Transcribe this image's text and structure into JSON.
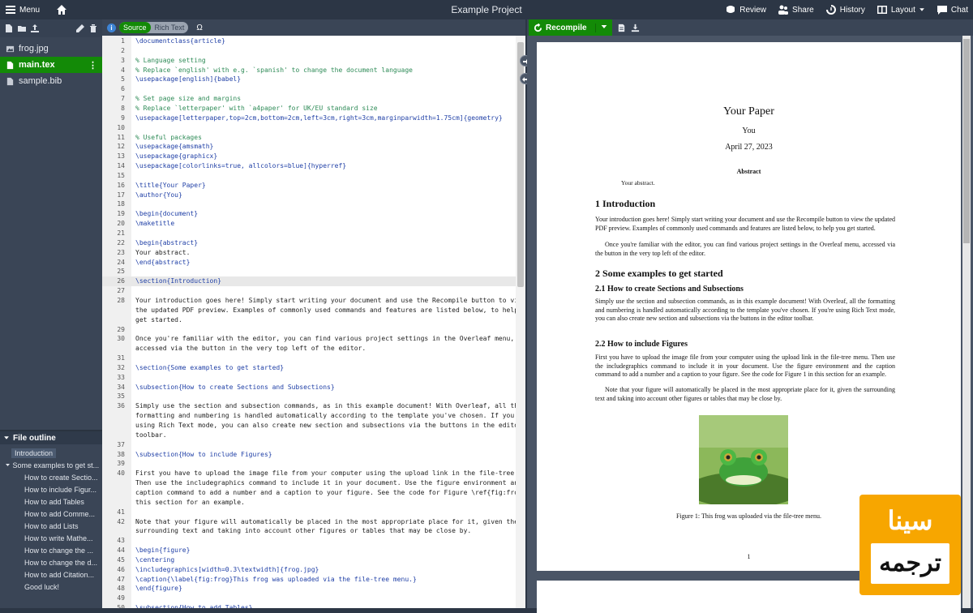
{
  "topbar": {
    "menu_label": "Menu",
    "project_title": "Example Project",
    "review": "Review",
    "share": "Share",
    "history": "History",
    "layout": "Layout",
    "chat": "Chat"
  },
  "files": [
    {
      "name": "frog.jpg"
    },
    {
      "name": "main.tex"
    },
    {
      "name": "sample.bib"
    }
  ],
  "outline": {
    "header": "File outline",
    "items": [
      {
        "label": "Introduction"
      },
      {
        "label": "Some examples to get st..."
      },
      {
        "label": "How to create Sectio..."
      },
      {
        "label": "How to include Figur..."
      },
      {
        "label": "How to add Tables"
      },
      {
        "label": "How to add Comme..."
      },
      {
        "label": "How to add Lists"
      },
      {
        "label": "How to write Mathe..."
      },
      {
        "label": "How to change the ..."
      },
      {
        "label": "How to change the d..."
      },
      {
        "label": "How to add Citation..."
      },
      {
        "label": "Good luck!"
      }
    ]
  },
  "editor": {
    "mode_source": "Source",
    "mode_rich": "Rich Text",
    "omega": "Ω",
    "info": "i",
    "lines": [
      {
        "n": "1",
        "t": "\\documentclass{article}"
      },
      {
        "n": "2",
        "t": ""
      },
      {
        "n": "3",
        "t": "% Language setting"
      },
      {
        "n": "4",
        "t": "% Replace `english' with e.g. `spanish' to change the document language"
      },
      {
        "n": "5",
        "t": "\\usepackage[english]{babel}"
      },
      {
        "n": "6",
        "t": ""
      },
      {
        "n": "7",
        "t": "% Set page size and margins"
      },
      {
        "n": "8",
        "t": "% Replace `letterpaper' with `a4paper' for UK/EU standard size"
      },
      {
        "n": "9",
        "t": "\\usepackage[letterpaper,top=2cm,bottom=2cm,left=3cm,right=3cm,marginparwidth=1.75cm]{geometry}"
      },
      {
        "n": "10",
        "t": ""
      },
      {
        "n": "11",
        "t": "% Useful packages"
      },
      {
        "n": "12",
        "t": "\\usepackage{amsmath}"
      },
      {
        "n": "13",
        "t": "\\usepackage{graphicx}"
      },
      {
        "n": "14",
        "t": "\\usepackage[colorlinks=true, allcolors=blue]{hyperref}"
      },
      {
        "n": "15",
        "t": ""
      },
      {
        "n": "16",
        "t": "\\title{Your Paper}"
      },
      {
        "n": "17",
        "t": "\\author{You}"
      },
      {
        "n": "18",
        "t": ""
      },
      {
        "n": "19",
        "t": "\\begin{document}"
      },
      {
        "n": "20",
        "t": "\\maketitle"
      },
      {
        "n": "21",
        "t": ""
      },
      {
        "n": "22",
        "t": "\\begin{abstract}"
      },
      {
        "n": "23",
        "t": "Your abstract."
      },
      {
        "n": "24",
        "t": "\\end{abstract}"
      },
      {
        "n": "25",
        "t": ""
      },
      {
        "n": "26",
        "t": "\\section{Introduction}"
      },
      {
        "n": "27",
        "t": ""
      },
      {
        "n": "28",
        "t": "Your introduction goes here! Simply start writing your document and use the Recompile button to view"
      },
      {
        "n": "",
        "t": "the updated PDF preview. Examples of commonly used commands and features are listed below, to help you"
      },
      {
        "n": "",
        "t": "get started."
      },
      {
        "n": "29",
        "t": ""
      },
      {
        "n": "30",
        "t": "Once you're familiar with the editor, you can find various project settings in the Overleaf menu,"
      },
      {
        "n": "",
        "t": "accessed via the button in the very top left of the editor."
      },
      {
        "n": "31",
        "t": ""
      },
      {
        "n": "32",
        "t": "\\section{Some examples to get started}"
      },
      {
        "n": "33",
        "t": ""
      },
      {
        "n": "34",
        "t": "\\subsection{How to create Sections and Subsections}"
      },
      {
        "n": "35",
        "t": ""
      },
      {
        "n": "36",
        "t": "Simply use the section and subsection commands, as in this example document! With Overleaf, all the"
      },
      {
        "n": "",
        "t": "formatting and numbering is handled automatically according to the template you've chosen. If you're"
      },
      {
        "n": "",
        "t": "using Rich Text mode, you can also create new section and subsections via the buttons in the editor"
      },
      {
        "n": "",
        "t": "toolbar."
      },
      {
        "n": "37",
        "t": ""
      },
      {
        "n": "38",
        "t": "\\subsection{How to include Figures}"
      },
      {
        "n": "39",
        "t": ""
      },
      {
        "n": "40",
        "t": "First you have to upload the image file from your computer using the upload link in the file-tree menu."
      },
      {
        "n": "",
        "t": "Then use the includegraphics command to include it in your document. Use the figure environment and the"
      },
      {
        "n": "",
        "t": "caption command to add a number and a caption to your figure. See the code for Figure \\ref{fig:frog} in"
      },
      {
        "n": "",
        "t": "this section for an example."
      },
      {
        "n": "41",
        "t": ""
      },
      {
        "n": "42",
        "t": "Note that your figure will automatically be placed in the most appropriate place for it, given the"
      },
      {
        "n": "",
        "t": "surrounding text and taking into account other figures or tables that may be close by."
      },
      {
        "n": "43",
        "t": ""
      },
      {
        "n": "44",
        "t": "\\begin{figure}"
      },
      {
        "n": "45",
        "t": "\\centering"
      },
      {
        "n": "46",
        "t": "\\includegraphics[width=0.3\\textwidth]{frog.jpg}"
      },
      {
        "n": "47",
        "t": "\\caption{\\label{fig:frog}This frog was uploaded via the file-tree menu.}"
      },
      {
        "n": "48",
        "t": "\\end{figure}"
      },
      {
        "n": "49",
        "t": ""
      },
      {
        "n": "50",
        "t": "\\subsection{How to add Tables}"
      }
    ]
  },
  "pdf": {
    "recompile": "Recompile",
    "title": "Your Paper",
    "author": "You",
    "date": "April 27, 2023",
    "abstract_head": "Abstract",
    "abstract_text": "Your abstract.",
    "s1": "1   Introduction",
    "s1_p1": "Your introduction goes here! Simply start writing your document and use the Recompile button to view the updated PDF preview. Examples of commonly used commands and features are listed below, to help you get started.",
    "s1_p2": "Once you're familiar with the editor, you can find various project settings in the Overleaf menu, accessed via the button in the very top left of the editor.",
    "s2": "2   Some examples to get started",
    "s21": "2.1   How to create Sections and Subsections",
    "s21_p": "Simply use the section and subsection commands, as in this example document! With Overleaf, all the formatting and numbering is handled automatically according to the template you've chosen. If you're using Rich Text mode, you can also create new section and subsections via the buttons in the editor toolbar.",
    "s22": "2.2   How to include Figures",
    "s22_p1": "First you have to upload the image file from your computer using the upload link in the file-tree menu. Then use the includegraphics command to include it in your document. Use the figure environment and the caption command to add a number and a caption to your figure. See the code for Figure 1 in this section for an example.",
    "s22_p2": "Note that your figure will automatically be placed in the most appropriate place for it, given the surrounding text and taking into account other figures or tables that may be close by.",
    "caption": "Figure 1: This frog was uploaded via the file-tree menu.",
    "page_num": "1"
  },
  "watermark": {
    "top": "سينا",
    "bottom": "ترجمه"
  },
  "colors": {
    "green": "#138a07",
    "chrome": "#2c3645",
    "orange": "#f7a600"
  }
}
